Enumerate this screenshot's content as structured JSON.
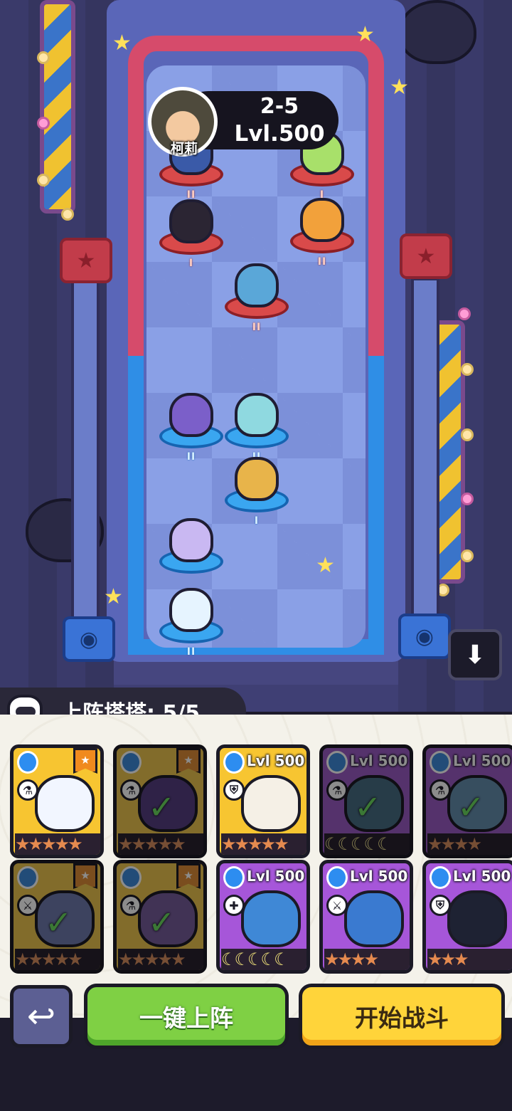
{
  "player": {
    "name": "柯莉",
    "stage": "2-5",
    "level": "Lvl.500"
  },
  "board": {
    "enemies": [
      {
        "tier": "II"
      },
      {
        "tier": "I"
      },
      {
        "tier": "I"
      },
      {
        "tier": "II"
      },
      {
        "tier": "II"
      }
    ],
    "allies": [
      {
        "tier": "II"
      },
      {
        "tier": "II"
      },
      {
        "tier": "I"
      },
      {
        "tier": ""
      },
      {
        "tier": "II"
      }
    ]
  },
  "deploy": {
    "label": "上阵塔塔: 5/5"
  },
  "cards": [
    {
      "level": "",
      "role": "⚗",
      "stars": "★★★★★",
      "selected": false,
      "flag": "★"
    },
    {
      "level": "",
      "role": "⚗",
      "stars": "★★★★★",
      "selected": true,
      "flag": "★"
    },
    {
      "level": "Lvl 500",
      "role": "⛨",
      "stars": "★★★★★",
      "selected": false,
      "flag": ""
    },
    {
      "level": "Lvl 500",
      "role": "⚗",
      "stars": "☾☾☾☾☾",
      "selected": true,
      "flag": ""
    },
    {
      "level": "Lvl 500",
      "role": "⚗",
      "stars": "★★★★",
      "selected": true,
      "flag": ""
    },
    {
      "level": "",
      "role": "⚔",
      "stars": "★★★★★",
      "selected": true,
      "flag": "★"
    },
    {
      "level": "",
      "role": "⚗",
      "stars": "★★★★★",
      "selected": true,
      "flag": "★"
    },
    {
      "level": "Lvl 500",
      "role": "✚",
      "stars": "☾☾☾☾☾",
      "selected": false,
      "flag": ""
    },
    {
      "level": "Lvl 500",
      "role": "⚔",
      "stars": "★★★★",
      "selected": false,
      "flag": ""
    },
    {
      "level": "Lvl 500",
      "role": "⛨",
      "stars": "★★★",
      "selected": false,
      "flag": ""
    }
  ],
  "buttons": {
    "back": "↩",
    "auto_deploy": "一键上阵",
    "start_battle": "开始战斗",
    "save": "⬇"
  },
  "colors": {
    "gold_card": "#f7c531",
    "purple_card": "#a656d9",
    "auto_deploy": "#7fd044",
    "start_battle": "#ffd43a"
  }
}
